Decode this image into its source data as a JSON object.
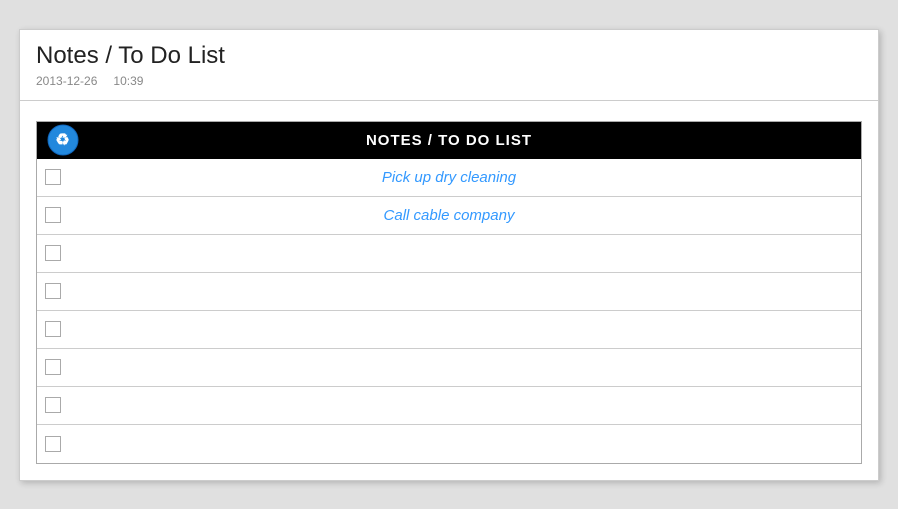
{
  "window": {
    "title": "Notes / To Do List",
    "date": "2013-12-26",
    "time": "10:39"
  },
  "app": {
    "header_title": "NOTES / TO DO LIST",
    "rows": [
      {
        "text": "Pick up dry cleaning",
        "checked": false
      },
      {
        "text": "Call cable company",
        "checked": false
      },
      {
        "text": "",
        "checked": false
      },
      {
        "text": "",
        "checked": false
      },
      {
        "text": "",
        "checked": false
      },
      {
        "text": "",
        "checked": false
      },
      {
        "text": "",
        "checked": false
      },
      {
        "text": "",
        "checked": false
      }
    ]
  }
}
